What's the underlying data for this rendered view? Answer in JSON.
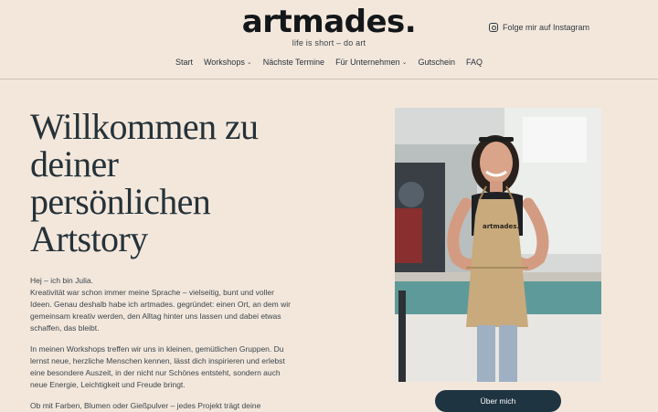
{
  "header": {
    "logo": "artmades.",
    "tagline": "life is short – do art",
    "instagram_label": "Folge mir auf Instagram"
  },
  "nav": {
    "items": [
      {
        "label": "Start",
        "dropdown": false
      },
      {
        "label": "Workshops",
        "dropdown": true
      },
      {
        "label": "Nächste Termine",
        "dropdown": false
      },
      {
        "label": "Für Unternehmen",
        "dropdown": true
      },
      {
        "label": "Gutschein",
        "dropdown": false
      },
      {
        "label": "FAQ",
        "dropdown": false
      }
    ]
  },
  "hero": {
    "title_lines": [
      "Willkommen zu",
      "deiner",
      "persönlichen",
      "Artstory"
    ],
    "intro_greeting": "Hej – ich bin Julia.",
    "intro_text": "Kreativität war schon immer meine Sprache – vielseitig, bunt und voller Ideen. Genau deshalb habe ich artmades. gegründet: einen Ort, an dem wir gemeinsam kreativ werden, den Alltag hinter uns lassen und dabei etwas schaffen, das bleibt.",
    "paragraph_2": "In meinen Workshops treffen wir uns in kleinen, gemütlichen Gruppen. Du lernst neue, herzliche Menschen kennen, lässt dich inspirieren und erlebst eine besondere Auszeit, in der nicht nur Schönes entsteht, sondern auch neue Energie, Leichtigkeit und Freude bringt.",
    "paragraph_3": "Ob mit Farben, Blumen oder Gießpulver – jedes Projekt trägt deine"
  },
  "photo": {
    "apron_text": "artmades."
  },
  "about_button": "Über mich",
  "colors": {
    "background": "#f3e7dc",
    "button": "#1f3441",
    "text": "#2f3a40"
  }
}
